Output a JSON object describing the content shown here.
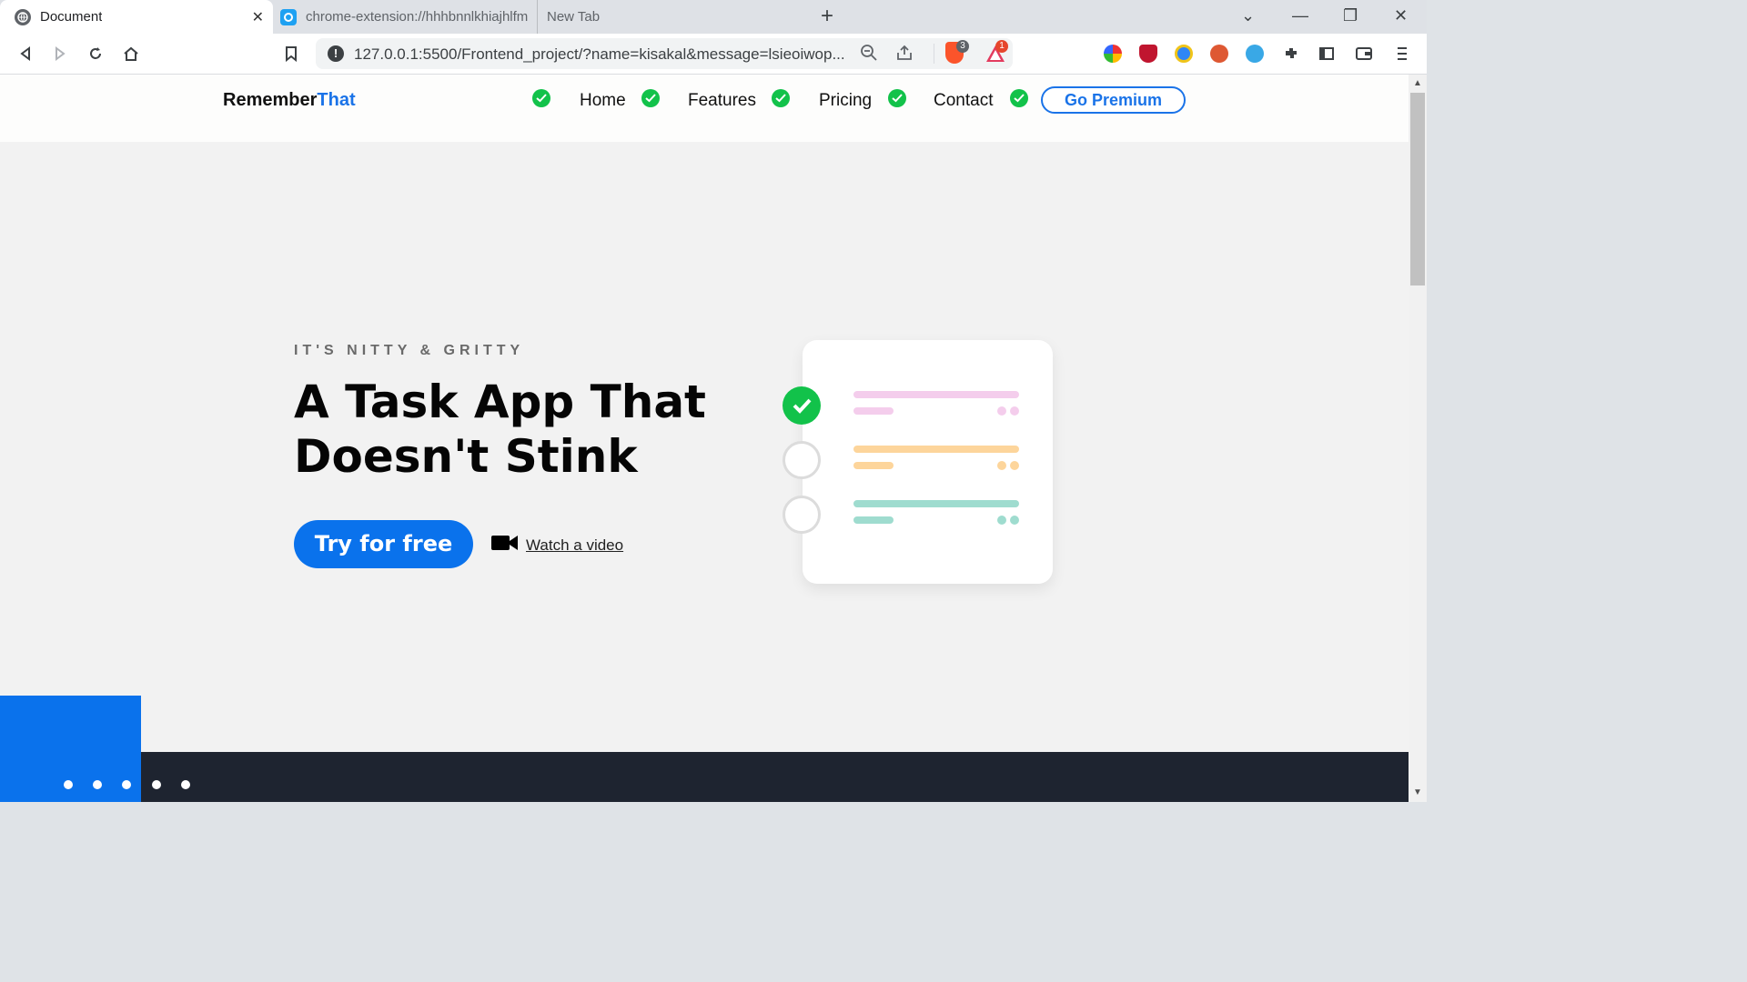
{
  "tabs": [
    {
      "title": "Document",
      "active": true
    },
    {
      "title": "chrome-extension://hhhbnnlkhiajhlfm",
      "active": false
    },
    {
      "title": "New Tab",
      "active": false
    }
  ],
  "toolbar": {
    "url": "127.0.0.1:5500/Frontend_project/?name=kisakal&message=lsieoiwop...",
    "brave_badge": "3",
    "rewards_badge": "1"
  },
  "site": {
    "logo_main": "Remember",
    "logo_accent": "That",
    "nav": [
      "Home",
      "Features",
      "Pricing",
      "Contact"
    ],
    "premium": "Go Premium"
  },
  "hero": {
    "eyebrow": "IT'S NITTY & GRITTY",
    "headline": "A Task App That Doesn't Stink",
    "cta": "Try for free",
    "video": "Watch a video"
  },
  "colors": {
    "accent": "#1a73e8",
    "check": "#12c24a",
    "pink": "#f4cdec",
    "orange": "#fdd59b",
    "teal": "#9fdccf",
    "dark": "#1e2430"
  }
}
